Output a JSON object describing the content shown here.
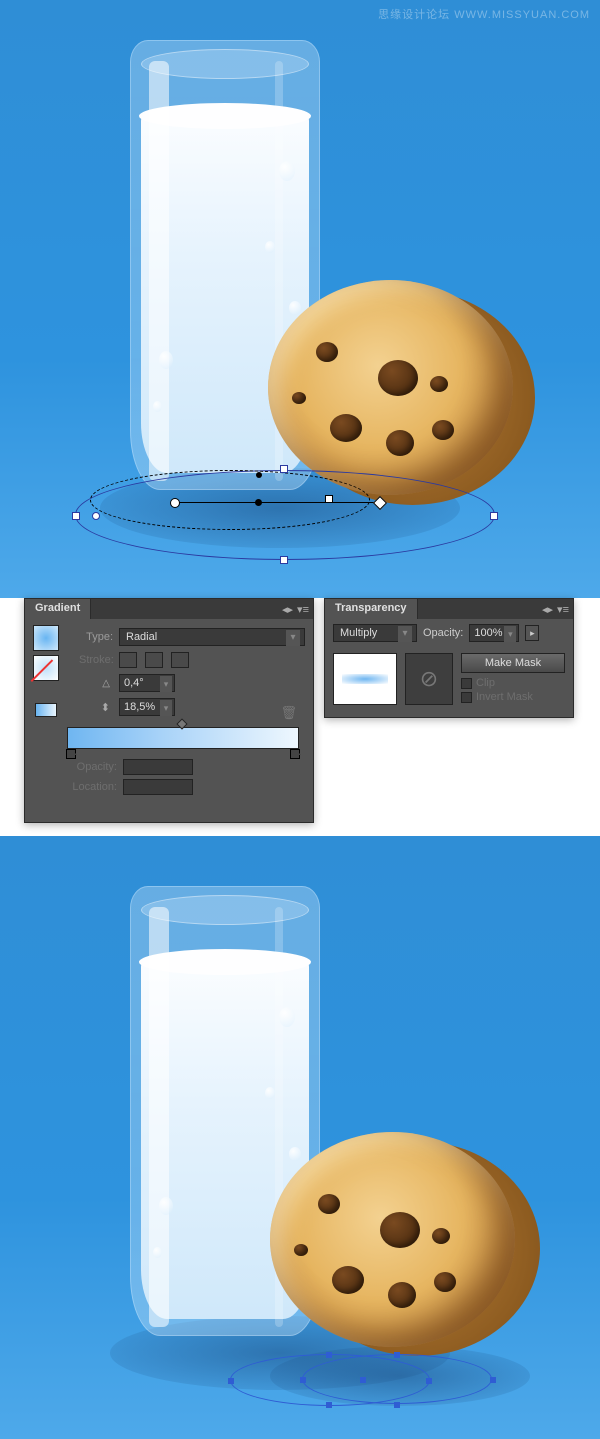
{
  "watermark": "思缘设计论坛  WWW.MISSYUAN.COM",
  "gradient_panel": {
    "title": "Gradient",
    "type_label": "Type:",
    "type_value": "Radial",
    "stroke_label": "Stroke:",
    "angle_value": "0,4°",
    "ratio_value": "18,5%",
    "opacity_label": "Opacity:",
    "location_label": "Location:"
  },
  "transparency_panel": {
    "title": "Transparency",
    "blend_value": "Multiply",
    "opacity_label": "Opacity:",
    "opacity_value": "100%",
    "make_mask": "Make Mask",
    "clip": "Clip",
    "invert": "Invert Mask"
  }
}
